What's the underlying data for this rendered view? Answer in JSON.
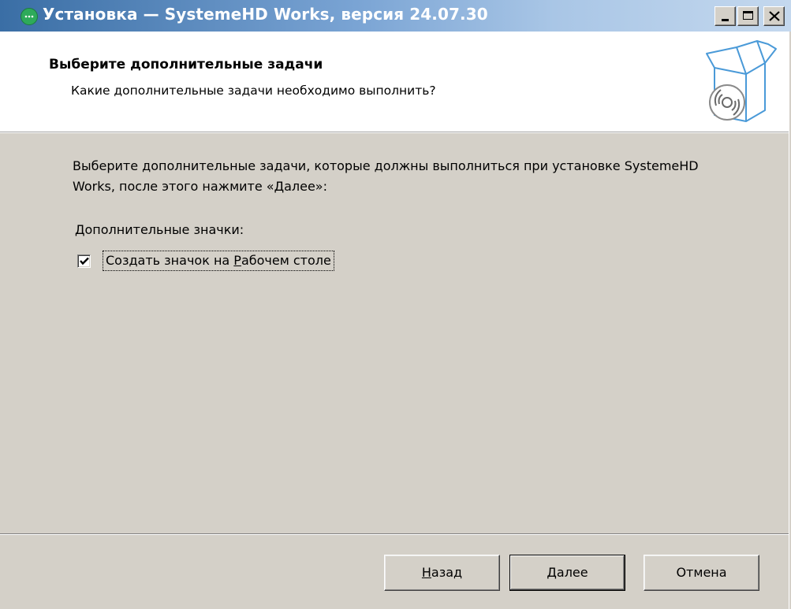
{
  "window": {
    "title": "Установка — SystemeHD Works, версия 24.07.30",
    "icon": "app-logo-icon",
    "controls": {
      "minimize_icon": "minimize-icon",
      "maximize_icon": "maximize-icon",
      "close_icon": "close-icon"
    }
  },
  "header": {
    "title": "Выберите дополнительные задачи",
    "subtitle": "Какие дополнительные задачи необходимо выполнить?",
    "graphic": "box-with-disc-icon"
  },
  "body": {
    "instruction": "Выберите дополнительные задачи, которые должны выполниться при установке SystemeHD Works, после этого нажмите «Далее»:",
    "group_label": "Дополнительные значки:",
    "tasks": [
      {
        "label_before": "Создать значок на ",
        "label_accel": "Р",
        "label_after": "абочем столе",
        "checked": true
      }
    ]
  },
  "buttons": {
    "back": {
      "accel": "Н",
      "rest": "азад"
    },
    "next": {
      "accel": "Д",
      "rest": "алее"
    },
    "cancel": {
      "label": "Отмена"
    }
  },
  "colors": {
    "titlebar_start": "#3a6ea5",
    "titlebar_end": "#c4d8ee",
    "face": "#d4d0c8",
    "header_bg": "#ffffff",
    "graphic_stroke": "#4a9ad8"
  }
}
